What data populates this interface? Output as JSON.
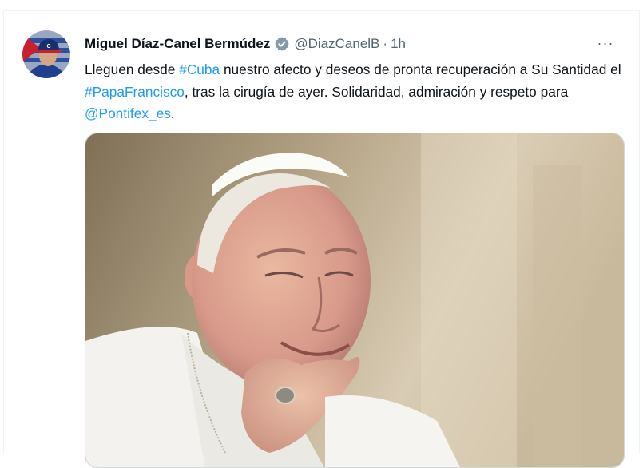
{
  "tweet": {
    "author_name": "Miguel Díaz-Canel Bermúdez",
    "handle": "@DiazCanelB",
    "separator": "·",
    "time": "1h",
    "more_label": "···",
    "text": {
      "part1": "Lleguen desde ",
      "hashtag1": "#Cuba",
      "part2": " nuestro afecto y deseos de pronta recuperación a Su Santidad el ",
      "hashtag2": "#PapaFrancisco",
      "part3": ", tras la cirugía de ayer. Solidaridad, admiración y respeto para ",
      "mention": "@Pontifex_es",
      "part4": "."
    },
    "verified_icon": "verified-badge-icon",
    "colors": {
      "link": "#1d9bf0",
      "secondary_text": "#536471",
      "verified_badge": "#829aab"
    }
  }
}
